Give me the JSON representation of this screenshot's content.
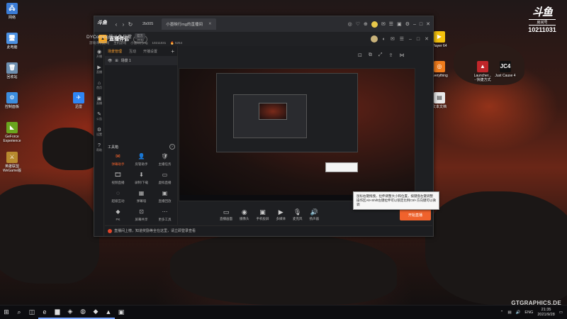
{
  "desktop": {
    "icons_left": [
      {
        "label": "网络",
        "icon": "network-icon",
        "glyph": "🖧",
        "color": "#3a7bd5"
      },
      {
        "label": "此电脑",
        "icon": "computer-icon",
        "glyph": "🖥",
        "color": "#4a90e2"
      },
      {
        "label": "回收站",
        "icon": "recycle-bin-icon",
        "glyph": "🗑",
        "color": "#6d8fb0"
      },
      {
        "label": "控制面板",
        "icon": "control-panel-icon",
        "glyph": "⚙",
        "color": "#3c8dde"
      },
      {
        "label": "GeForce\nExperience",
        "icon": "geforce-icon",
        "glyph": "◣",
        "color": "#6aa51e"
      },
      {
        "label": "英雄联盟\nWeGame版",
        "icon": "league-icon",
        "glyph": "⚔",
        "color": "#b88a2e"
      }
    ],
    "icon_mid": {
      "label": "迅雷",
      "icon": "xunlei-icon",
      "glyph": "✈",
      "color": "#2f86f6"
    },
    "icons_right": [
      {
        "label": "Player 64",
        "icon": "player-icon",
        "glyph": "▶",
        "color": "#f4c20d"
      },
      {
        "label": "Everything",
        "icon": "everything-icon",
        "glyph": "◎",
        "color": "#f07c1c"
      },
      {
        "label": "文本文档",
        "icon": "text-doc-icon",
        "glyph": "▤",
        "color": "#e9e9e9"
      }
    ],
    "icons_far_right": [
      {
        "label": "Launcher...\n- 快捷方式",
        "icon": "launcher-icon",
        "glyph": "▲",
        "color": "#c0262a"
      },
      {
        "label": "Just Cause 4",
        "icon": "just-cause-icon",
        "glyph": "JC4",
        "color": "#111111"
      }
    ]
  },
  "watermark": {
    "logo": "斗鱼",
    "sub": "房间号",
    "room": "10211031"
  },
  "brand_corner": "GTGRAPHICS.DE",
  "browser": {
    "logo": "斗鱼",
    "back": "‹",
    "forward": "›",
    "refresh": "↻",
    "tabs": [
      {
        "label": "2b005",
        "active": false
      },
      {
        "label": "小墨映行mg的直播间",
        "active": true
      }
    ],
    "close_tab": "✕"
  },
  "app": {
    "name": "直播伴侣",
    "badge": "体验",
    "panel_tabs": [
      "场景管理",
      "互动",
      "开播设置"
    ],
    "scene": "场景 1",
    "tools_title": "工具箱",
    "tools": [
      {
        "label": "弹幕助手",
        "glyph": "✉",
        "hot": true
      },
      {
        "label": "房管助手",
        "glyph": "👤",
        "hot": false
      },
      {
        "label": "主播任务",
        "glyph": "🛡",
        "hot": false
      },
      {
        "label": "视频直播",
        "glyph": "🎞",
        "hot": false
      },
      {
        "label": "录制/下载",
        "glyph": "⬇",
        "hot": false
      },
      {
        "label": "虚拟直播",
        "glyph": "▭",
        "hot": false
      },
      {
        "label": "超级互动",
        "glyph": "◌",
        "hot": false
      },
      {
        "label": "弹幕墙",
        "glyph": "▦",
        "hot": false
      },
      {
        "label": "直播回放",
        "glyph": "▣",
        "hot": false
      },
      {
        "label": "PK",
        "glyph": "◆",
        "hot": false
      },
      {
        "label": "屏幕共享",
        "glyph": "⊡",
        "hot": false
      },
      {
        "label": "更多工具",
        "glyph": "⋯",
        "hot": false
      }
    ],
    "rail": [
      {
        "label": "开播",
        "glyph": "◉"
      },
      {
        "label": "直播",
        "glyph": "▶"
      },
      {
        "label": "首页",
        "glyph": "⌂"
      },
      {
        "label": "直播",
        "glyph": "▣"
      },
      {
        "label": "公告",
        "glyph": "✎"
      },
      {
        "label": "设置",
        "glyph": "⚙"
      },
      {
        "label": "帮助",
        "glyph": "?"
      }
    ],
    "notice": "直播间上榜，知道奖励等全在这里，请立即登录查看",
    "stage_title": "DYComing的斗鱼日常",
    "stage_tag": "官方",
    "stage_meta": [
      "游戏/单机游戏",
      "主机游戏",
      "小墨映行mg",
      "10211031",
      "🔥 5254"
    ],
    "toolbar": [
      {
        "label": "直播画面",
        "glyph": "▭"
      },
      {
        "label": "摄像头",
        "glyph": "◉"
      },
      {
        "label": "手机投屏",
        "glyph": "▣"
      },
      {
        "label": "多媒体",
        "glyph": "▶"
      },
      {
        "label": "麦克风",
        "glyph": "🎙"
      },
      {
        "label": "扬声器",
        "glyph": "🔊"
      }
    ],
    "live_button": "开始直播"
  },
  "hint": "鼠标右键拖拽，拉伸调整大小和位置，按键盘左键调整操作区Alt+Shift左键拉伸可以锁定比例Ctrl+方向键可以微调",
  "taskbar": {
    "items": [
      {
        "name": "start-button",
        "glyph": "⊞"
      },
      {
        "name": "search-icon",
        "glyph": "⌕"
      },
      {
        "name": "task-view-icon",
        "glyph": "◫"
      },
      {
        "name": "edge-icon",
        "glyph": "e"
      },
      {
        "name": "folder-icon",
        "glyph": "▆"
      },
      {
        "name": "douyu-icon",
        "glyph": "◈"
      },
      {
        "name": "steam-icon",
        "glyph": "◍"
      },
      {
        "name": "unity-icon",
        "glyph": "◆"
      },
      {
        "name": "companion-icon",
        "glyph": "▲"
      },
      {
        "name": "terminal-icon",
        "glyph": "▣"
      }
    ],
    "lang": "ENG",
    "time": "21:35",
    "date": "2021/9/28"
  }
}
